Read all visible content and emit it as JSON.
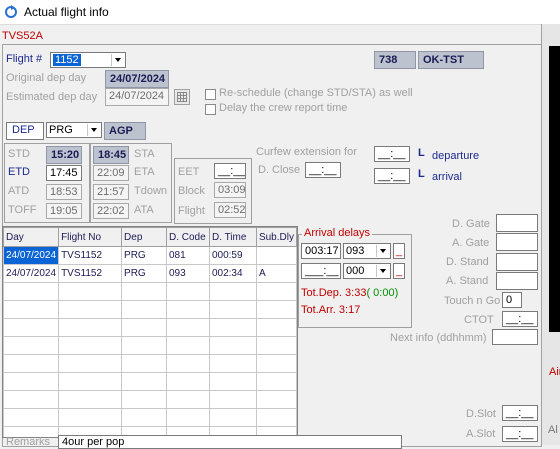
{
  "window": {
    "title": "Actual flight info"
  },
  "registration": "TVS52A",
  "flight": {
    "label": "Flight #",
    "number": "1152",
    "aircraft_type": "738",
    "aircraft_reg": "OK-TST",
    "original_dep_label": "Original dep day",
    "original_dep_value": "24/07/2024",
    "estimated_dep_label": "Estimated dep day",
    "estimated_dep_value": "24/07/2024",
    "reschedule_label": "Re-schedule (change STD/STA) as well",
    "delay_report_label": "Delay the crew report time"
  },
  "route": {
    "dep_label": "DEP",
    "dep_airport": "PRG",
    "arr_airport": "AGP"
  },
  "times": {
    "std_label": "STD",
    "std_value": "15:20",
    "etd_label": "ETD",
    "etd_value": "17:45",
    "atd_label": "ATD",
    "atd_value": "18:53",
    "toff_label": "TOFF",
    "toff_value": "19:05",
    "sta_value": "18:45",
    "sta_label": "STA",
    "eta_value": "22:09",
    "eta_label": "ETA",
    "tdown_value": "21:57",
    "tdown_label": "Tdown",
    "ata_value": "22:02",
    "ata_label": "ATA",
    "eet_label": "EET",
    "eet_value": "__:__",
    "dclose_label": "D. Close",
    "dclose_value": "__:__",
    "block_label": "Block",
    "block_value": "03:09",
    "flight_label": "Flight",
    "flight_value": "02:52"
  },
  "curfew": {
    "label": "Curfew extension for",
    "dep_value": "__:__",
    "dep_unit": "L",
    "dep_label": "departure",
    "arr_value": "__:__",
    "arr_unit": "L",
    "arr_label": "arrival"
  },
  "delay_table": {
    "headers": [
      "Day",
      "Flight No",
      "Dep",
      "D. Code",
      "D. Time",
      "Sub.Dly"
    ],
    "rows": [
      [
        "24/07/2024",
        "TVS1152",
        "PRG",
        "081",
        "000:59",
        ""
      ],
      [
        "24/07/2024",
        "TVS1152",
        "PRG",
        "093",
        "002:34",
        "A"
      ]
    ]
  },
  "arrival_delays": {
    "title": "Arrival delays",
    "row1_time": "003:17",
    "row1_code": "093",
    "row1_mark": "_",
    "row2_time": "___:__",
    "row2_code": "000",
    "row2_mark": "_",
    "tot_dep_label": "Tot.Dep. 3:33",
    "tot_dep_extra": "( 0:00)",
    "tot_arr_label": "Tot.Arr.  3:17"
  },
  "right_fields": {
    "dgate_label": "D. Gate",
    "agate_label": "A. Gate",
    "dstand_label": "D. Stand",
    "astand_label": "A. Stand",
    "touchngo_label": "Touch n Go",
    "touchngo_value": "0",
    "ctot_label": "CTOT",
    "ctot_value": "__:__",
    "nextinfo_label": "Next info (ddhhmm)",
    "dslot_label": "D.Slot",
    "dslot_value": "__:__",
    "aslot_label": "A.Slot",
    "aslot_value": "__:__"
  },
  "remarks": {
    "label": "Remarks",
    "value": "4our per pop"
  },
  "side": {
    "air_label": "Air",
    "al_label": "Al"
  }
}
